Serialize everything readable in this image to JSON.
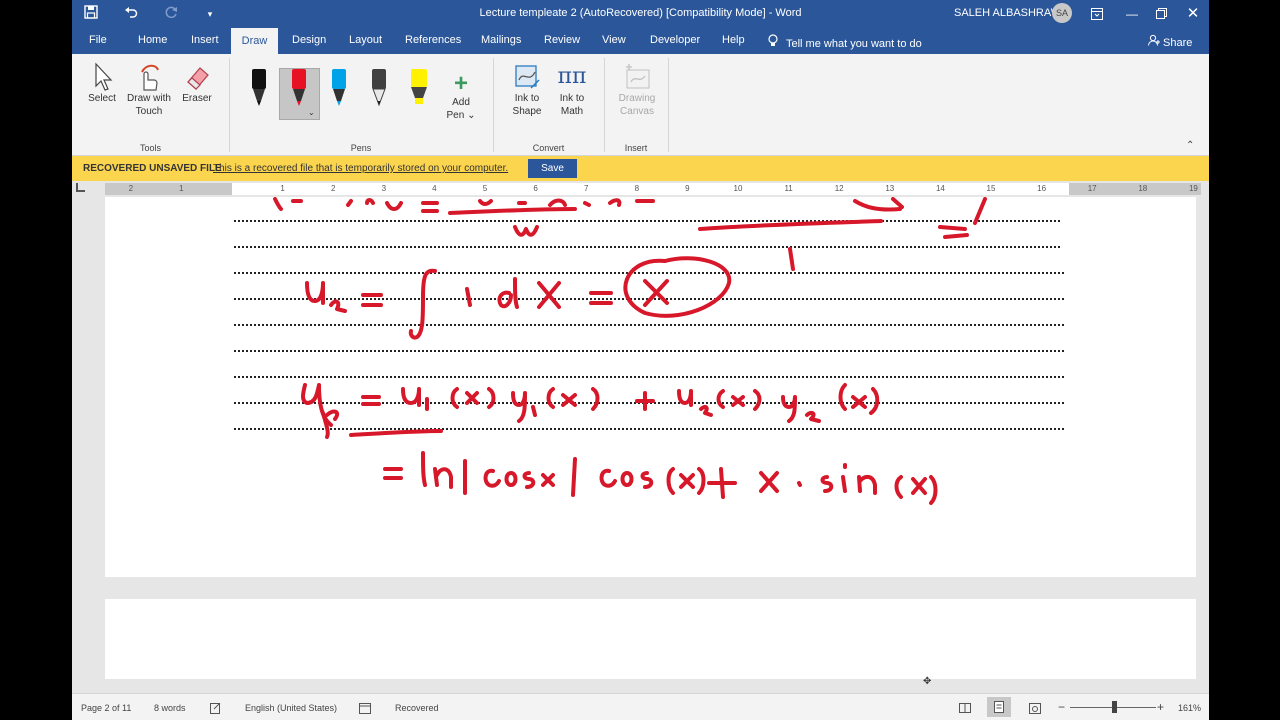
{
  "titlebar": {
    "document_title": "Lecture templeate 2 (AutoRecovered) [Compatibility Mode]  -  Word",
    "user_name": "SALEH ALBASHRAWI",
    "user_initials": "SA"
  },
  "tabs": {
    "file": "File",
    "home": "Home",
    "insert": "Insert",
    "draw": "Draw",
    "design": "Design",
    "layout": "Layout",
    "references": "References",
    "mailings": "Mailings",
    "review": "Review",
    "view": "View",
    "developer": "Developer",
    "help": "Help",
    "tell_me": "Tell me what you want to do",
    "share": "Share"
  },
  "ribbon": {
    "tools": {
      "label": "Tools",
      "select": "Select",
      "draw_with_touch_1": "Draw with",
      "draw_with_touch_2": "Touch",
      "eraser": "Eraser"
    },
    "pens": {
      "label": "Pens",
      "add_pen_1": "Add",
      "add_pen_2": "Pen"
    },
    "convert": {
      "label": "Convert",
      "ink_to_shape_1": "Ink to",
      "ink_to_shape_2": "Shape",
      "ink_to_math_1": "Ink to",
      "ink_to_math_2": "Math"
    },
    "insert": {
      "label": "Insert",
      "drawing_canvas_1": "Drawing",
      "drawing_canvas_2": "Canvas"
    },
    "pen_colors": [
      "#000000",
      "#e81123",
      "#00a2e8",
      "#404040",
      "#fff100"
    ]
  },
  "message_bar": {
    "title": "RECOVERED UNSAVED FILE",
    "text": "This is a recovered file that is temporarily stored on your computer.",
    "save": "Save"
  },
  "ruler": {
    "left_labels": [
      "2",
      "1"
    ],
    "right_labels": [
      "1",
      "2",
      "3",
      "4",
      "5",
      "6",
      "7",
      "8",
      "9",
      "10",
      "11",
      "12",
      "13",
      "14",
      "15",
      "16",
      "17",
      "18",
      "19"
    ]
  },
  "status": {
    "page": "Page 2 of 11",
    "words": "8 words",
    "language": "English (United States)",
    "recovered": "Recovered",
    "zoom": "161%"
  },
  "colors": {
    "accent": "#2b579a",
    "ink": "#d7182a",
    "message_bar": "#fcd54f"
  }
}
